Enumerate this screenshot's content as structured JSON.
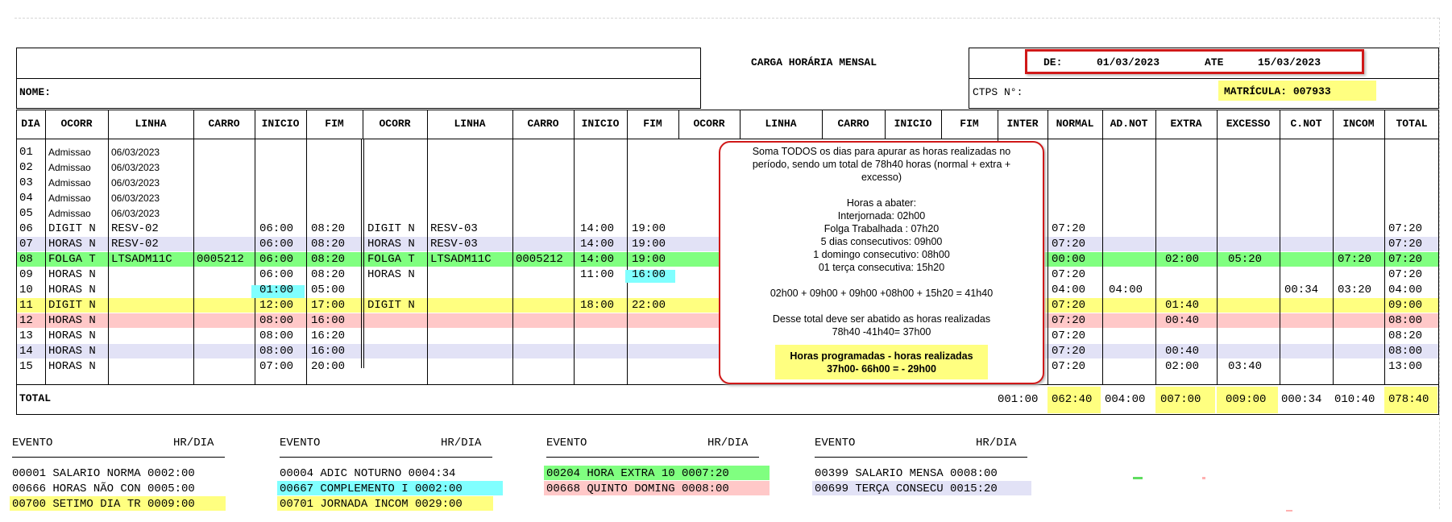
{
  "header": {
    "title": "CARGA HORÁRIA MENSAL",
    "nome_label": "NOME:",
    "ctps_label": "CTPS N°:",
    "de_label": "DE:",
    "de_value": "01/03/2023",
    "ate_label": "ATE",
    "ate_value": "15/03/2023",
    "matricula": "MATRÍCULA: 007933"
  },
  "columns": [
    "DIA",
    "OCORR",
    "LINHA",
    "CARRO",
    "INICIO",
    "FIM",
    "OCORR",
    "LINHA",
    "CARRO",
    "INICIO",
    "FIM",
    "OCORR",
    "LINHA",
    "CARRO",
    "INICIO",
    "FIM",
    "INTER",
    "NORMAL",
    "AD.NOT",
    "EXTRA",
    "EXCESSO",
    "C.NOT",
    "INCOM",
    "TOTAL"
  ],
  "rows": [
    {
      "dia": "01",
      "ocorr1": "Admissao",
      "linha1": "06/03/2023",
      "carro1": "",
      "inicio1": "",
      "fim1": "",
      "ocorr2": "",
      "linha2": "",
      "carro2": "",
      "inicio2": "",
      "fim2": "",
      "normal": "",
      "adnot": "",
      "extra": "",
      "excesso": "",
      "cnot": "",
      "incom": "",
      "total": ""
    },
    {
      "dia": "02",
      "ocorr1": "Admissao",
      "linha1": "06/03/2023",
      "carro1": "",
      "inicio1": "",
      "fim1": "",
      "ocorr2": "",
      "linha2": "",
      "carro2": "",
      "inicio2": "",
      "fim2": "",
      "normal": "",
      "adnot": "",
      "extra": "",
      "excesso": "",
      "cnot": "",
      "incom": "",
      "total": ""
    },
    {
      "dia": "03",
      "ocorr1": "Admissao",
      "linha1": "06/03/2023",
      "carro1": "",
      "inicio1": "",
      "fim1": "",
      "ocorr2": "",
      "linha2": "",
      "carro2": "",
      "inicio2": "",
      "fim2": "",
      "normal": "",
      "adnot": "",
      "extra": "",
      "excesso": "",
      "cnot": "",
      "incom": "",
      "total": ""
    },
    {
      "dia": "04",
      "ocorr1": "Admissao",
      "linha1": "06/03/2023",
      "carro1": "",
      "inicio1": "",
      "fim1": "",
      "ocorr2": "",
      "linha2": "",
      "carro2": "",
      "inicio2": "",
      "fim2": "",
      "normal": "",
      "adnot": "",
      "extra": "",
      "excesso": "",
      "cnot": "",
      "incom": "",
      "total": ""
    },
    {
      "dia": "05",
      "ocorr1": "Admissao",
      "linha1": "06/03/2023",
      "carro1": "",
      "inicio1": "",
      "fim1": "",
      "ocorr2": "",
      "linha2": "",
      "carro2": "",
      "inicio2": "",
      "fim2": "",
      "normal": "",
      "adnot": "",
      "extra": "",
      "excesso": "",
      "cnot": "",
      "incom": "",
      "total": ""
    },
    {
      "dia": "06",
      "ocorr1": "DIGIT N",
      "linha1": "RESV-02",
      "carro1": "",
      "inicio1": "06:00",
      "fim1": "08:20",
      "ocorr2": "DIGIT N",
      "linha2": "RESV-03",
      "carro2": "",
      "inicio2": "14:00",
      "fim2": "19:00",
      "normal": "07:20",
      "adnot": "",
      "extra": "",
      "excesso": "",
      "cnot": "",
      "incom": "",
      "total": "07:20"
    },
    {
      "dia": "07",
      "ocorr1": "HORAS N",
      "linha1": "RESV-02",
      "carro1": "",
      "inicio1": "06:00",
      "fim1": "08:20",
      "ocorr2": "HORAS N",
      "linha2": "RESV-03",
      "carro2": "",
      "inicio2": "14:00",
      "fim2": "19:00",
      "normal": "07:20",
      "adnot": "",
      "extra": "",
      "excesso": "",
      "cnot": "",
      "incom": "",
      "total": "07:20"
    },
    {
      "dia": "08",
      "ocorr1": "FOLGA T",
      "linha1": "LTSADM11C",
      "carro1": "0005212",
      "inicio1": "06:00",
      "fim1": "08:20",
      "ocorr2": "FOLGA T",
      "linha2": "LTSADM11C",
      "carro2": "0005212",
      "inicio2": "14:00",
      "fim2": "19:00",
      "normal": "00:00",
      "adnot": "",
      "extra": "02:00",
      "excesso": "05:20",
      "cnot": "",
      "incom": "07:20",
      "total": "07:20"
    },
    {
      "dia": "09",
      "ocorr1": "HORAS N",
      "linha1": "",
      "carro1": "",
      "inicio1": "06:00",
      "fim1": "08:20",
      "ocorr2": "HORAS N",
      "linha2": "",
      "carro2": "",
      "inicio2": "11:00",
      "fim2": "16:00",
      "normal": "07:20",
      "adnot": "",
      "extra": "",
      "excesso": "",
      "cnot": "",
      "incom": "",
      "total": "07:20"
    },
    {
      "dia": "10",
      "ocorr1": "HORAS N",
      "linha1": "",
      "carro1": "",
      "inicio1": "01:00",
      "fim1": "05:00",
      "ocorr2": "",
      "linha2": "",
      "carro2": "",
      "inicio2": "",
      "fim2": "",
      "normal": "04:00",
      "adnot": "04:00",
      "extra": "",
      "excesso": "",
      "cnot": "00:34",
      "incom": "03:20",
      "total": "04:00"
    },
    {
      "dia": "11",
      "ocorr1": "DIGIT N",
      "linha1": "",
      "carro1": "",
      "inicio1": "12:00",
      "fim1": "17:00",
      "ocorr2": "DIGIT N",
      "linha2": "",
      "carro2": "",
      "inicio2": "18:00",
      "fim2": "22:00",
      "normal": "07:20",
      "adnot": "",
      "extra": "01:40",
      "excesso": "",
      "cnot": "",
      "incom": "",
      "total": "09:00"
    },
    {
      "dia": "12",
      "ocorr1": "HORAS N",
      "linha1": "",
      "carro1": "",
      "inicio1": "08:00",
      "fim1": "16:00",
      "ocorr2": "",
      "linha2": "",
      "carro2": "",
      "inicio2": "",
      "fim2": "",
      "normal": "07:20",
      "adnot": "",
      "extra": "00:40",
      "excesso": "",
      "cnot": "",
      "incom": "",
      "total": "08:00"
    },
    {
      "dia": "13",
      "ocorr1": "HORAS N",
      "linha1": "",
      "carro1": "",
      "inicio1": "08:00",
      "fim1": "16:20",
      "ocorr2": "",
      "linha2": "",
      "carro2": "",
      "inicio2": "",
      "fim2": "",
      "normal": "07:20",
      "adnot": "",
      "extra": "",
      "excesso": "",
      "cnot": "",
      "incom": "",
      "total": "08:20"
    },
    {
      "dia": "14",
      "ocorr1": "HORAS N",
      "linha1": "",
      "carro1": "",
      "inicio1": "08:00",
      "fim1": "16:00",
      "ocorr2": "",
      "linha2": "",
      "carro2": "",
      "inicio2": "",
      "fim2": "",
      "normal": "07:20",
      "adnot": "",
      "extra": "00:40",
      "excesso": "",
      "cnot": "",
      "incom": "",
      "total": "08:00"
    },
    {
      "dia": "15",
      "ocorr1": "HORAS N",
      "linha1": "",
      "carro1": "",
      "inicio1": "07:00",
      "fim1": "20:00",
      "ocorr2": "",
      "linha2": "",
      "carro2": "",
      "inicio2": "",
      "fim2": "",
      "normal": "07:20",
      "adnot": "",
      "extra": "02:00",
      "excesso": "03:40",
      "cnot": "",
      "incom": "",
      "total": "13:00"
    }
  ],
  "totals": {
    "label": "TOTAL",
    "inter": "001:00",
    "normal": "062:40",
    "adnot": "004:00",
    "extra": "007:00",
    "excesso": "009:00",
    "cnot": "000:34",
    "incom": "010:40",
    "total": "078:40"
  },
  "callout": {
    "lines": [
      "Soma TODOS os dias para apurar as horas realizadas no",
      "período, sendo um total de 78h40 horas (normal + extra +",
      "excesso)",
      "",
      "Horas a abater:",
      "Interjornada: 02h00",
      "Folga Trabalhada : 07h20",
      "5 dias consecutivos: 09h00",
      "1 domingo consecutivo: 08h00",
      "01 terça consecutiva: 15h20",
      "",
      "02h00 + 09h00 + 09h00 +08h00 + 15h20 = 41h40",
      "",
      "Desse total deve ser abatido as horas realizadas",
      "78h40 -41h40= 37h00"
    ],
    "highlight_lines": [
      "Horas programadas - horas realizadas",
      "37h00- 66h00 = - 29h00"
    ]
  },
  "events": {
    "header_evento": "EVENTO",
    "header_hrdia": "HR/DIA",
    "groups": [
      [
        "00001 SALARIO NORMA 0002:00",
        "00666 HORAS NÃO CON 0005:00",
        "00700 SETIMO DIA TR 0009:00"
      ],
      [
        "00004 ADIC NOTURNO  0004:34",
        "00667 COMPLEMENTO I 0002:00",
        "00701 JORNADA INCOM 0029:00"
      ],
      [
        "00204 HORA EXTRA 10 0007:20",
        "00668 QUINTO DOMING 0008:00"
      ],
      [
        "00399 SALARIO MENSA 0008:00",
        "00699 TERÇA CONSECU 0015:20"
      ]
    ]
  },
  "colors": {
    "yellow": "#ffff80",
    "green": "#80ff80",
    "pink": "#ffc8c8",
    "lavender": "#e2e2f6",
    "cyan": "#80ffff",
    "red": "#d01818"
  }
}
